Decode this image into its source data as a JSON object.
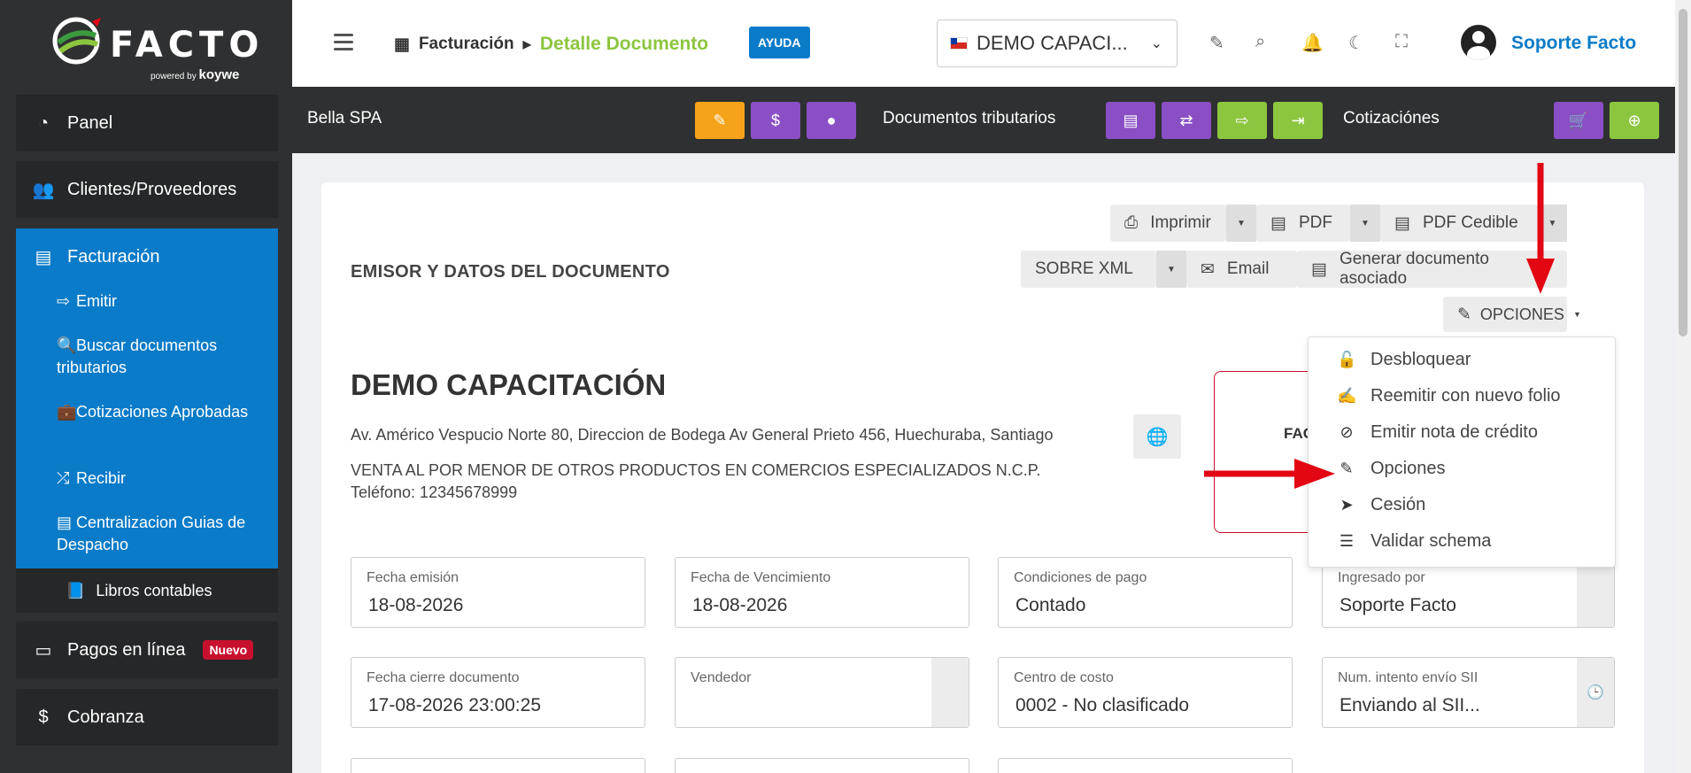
{
  "brand": {
    "name": "FACTO",
    "powered": "powered",
    "by": "by",
    "partner": "koywe"
  },
  "sidebar": {
    "items": [
      {
        "label": "Panel",
        "icon": "chart-pie-icon"
      },
      {
        "label": "Clientes/Proveedores",
        "icon": "users-icon"
      },
      {
        "label": "Pagos en línea",
        "badge": "Nuevo",
        "icon": "money-icon"
      },
      {
        "label": "Cobranza",
        "icon": "dollar-icon"
      }
    ],
    "active": {
      "label": "Facturación",
      "subitems": [
        {
          "label": "Emitir"
        },
        {
          "label": "Buscar documentos tributarios"
        },
        {
          "label": "Cotizaciones Aprobadas"
        },
        {
          "label": "Recibir"
        },
        {
          "label": "Centralizacion Guias de Despacho"
        }
      ]
    },
    "libros": "Libros contables"
  },
  "topbar": {
    "breadcrumb_root": "Facturación",
    "breadcrumb_current": "Detalle Documento",
    "help": "AYUDA",
    "company": "DEMO CAPACI...",
    "user": "Soporte Facto"
  },
  "toolbar": {
    "client": "Bella SPA",
    "docs_label": "Documentos tributarios",
    "quotes_label": "Cotizaciónes"
  },
  "actions": {
    "print": "Imprimir",
    "pdf": "PDF",
    "pdf_cedible": "PDF Cedible",
    "xml": "SOBRE XML",
    "email": "Email",
    "generate": "Generar documento asociado",
    "options": "OPCIONES"
  },
  "document": {
    "section_title": "EMISOR Y DATOS DEL DOCUMENTO",
    "company": "DEMO CAPACITACIÓN",
    "address": "Av. Américo Vespucio Norte 80, Direccion de Bodega Av General Prieto 456, Huechuraba, Santiago",
    "giro": "VENTA AL POR MENOR DE OTROS PRODUCTOS EN COMERCIOS ESPECIALIZADOS N.C.P.",
    "phone": "Teléfono: 12345678999",
    "type_prefix": "FAC"
  },
  "fields": [
    {
      "label": "Fecha emisión",
      "value": "18-08-2026"
    },
    {
      "label": "Fecha de Vencimiento",
      "value": "18-08-2026"
    },
    {
      "label": "Condiciones de pago",
      "value": "Contado"
    },
    {
      "label": "Ingresado por",
      "value": "Soporte Facto"
    },
    {
      "label": "Fecha cierre documento",
      "value": "17-08-2026 23:00:25"
    },
    {
      "label": "Vendedor",
      "value": ""
    },
    {
      "label": "Centro de costo",
      "value": "0002 - No clasificado"
    },
    {
      "label": "Num. intento envío SII",
      "value": "Enviando al SII..."
    }
  ],
  "dropdown": [
    {
      "label": "Desbloquear",
      "icon": "unlock-icon"
    },
    {
      "label": "Reemitir con nuevo folio",
      "icon": "file-signature-icon"
    },
    {
      "label": "Emitir nota de crédito",
      "icon": "ban-icon"
    },
    {
      "label": "Opciones",
      "icon": "edit-icon"
    },
    {
      "label": "Cesión",
      "icon": "location-arrow-icon"
    },
    {
      "label": "Validar schema",
      "icon": "list-check-icon"
    }
  ],
  "colors": {
    "accent": "#0a7bc8",
    "green": "#8cc63f",
    "purple": "#8a4fc4",
    "orange": "#f5a31a",
    "red": "#e30613",
    "sidebar": "#2f3031"
  }
}
